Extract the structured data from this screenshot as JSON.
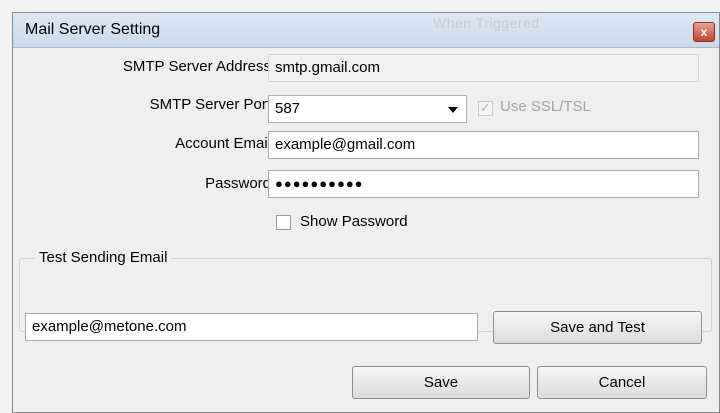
{
  "window": {
    "title": "Mail Server Setting",
    "background_title": "When Triggered",
    "close_glyph": "x"
  },
  "form": {
    "smtp_address_label": "SMTP Server Address",
    "smtp_address_value": "smtp.gmail.com",
    "smtp_port_label": "SMTP Server Port",
    "smtp_port_value": "587",
    "use_ssl_label": "Use SSL/TSL",
    "use_ssl_checked": true,
    "use_ssl_check_glyph": "✓",
    "account_email_label": "Account Email",
    "account_email_value": "example@gmail.com",
    "password_label": "Password",
    "password_value": "●●●●●●●●●●",
    "show_password_label": "Show Password",
    "show_password_checked": false
  },
  "test": {
    "group_label": "Test Sending Email",
    "email_value": "example@metone.com",
    "save_and_test_label": "Save and Test"
  },
  "footer": {
    "save_label": "Save",
    "cancel_label": "Cancel"
  }
}
